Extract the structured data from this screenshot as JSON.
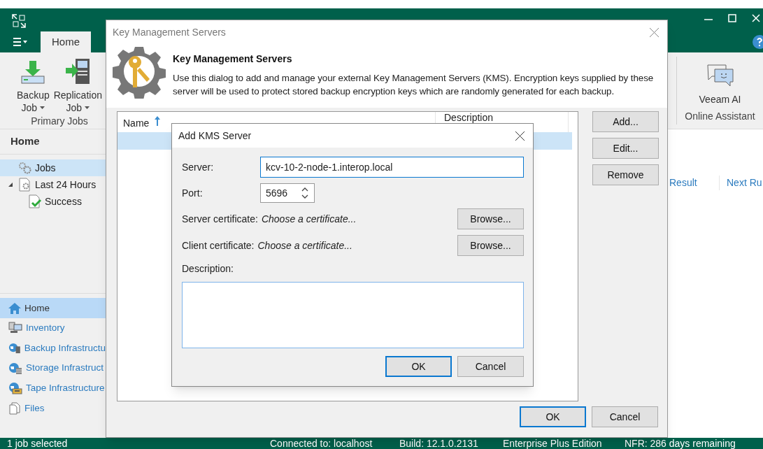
{
  "tabs": [
    {
      "label": "Home",
      "selected": true
    }
  ],
  "ribbon": {
    "groups": [
      {
        "label": "Primary Jobs",
        "buttons": [
          {
            "kind": "backup",
            "line1": "Backup",
            "line2": "Job"
          },
          {
            "kind": "replication",
            "line1": "Replication",
            "line2": "Job"
          }
        ]
      },
      {
        "label": "Online Assistant",
        "buttons": [
          {
            "kind": "assistant",
            "line1": "Veeam AI"
          }
        ]
      }
    ]
  },
  "sidebar": {
    "title": "Home",
    "tree": [
      {
        "label": "Jobs",
        "kind": "jobs",
        "selected": true
      },
      {
        "label": "Last 24 Hours",
        "kind": "history",
        "selected": false,
        "expanded": true,
        "children": [
          {
            "label": "Success",
            "kind": "success",
            "selected": false
          }
        ]
      }
    ],
    "nav": [
      {
        "label": "Home",
        "kind": "home",
        "selected": true
      },
      {
        "label": "Inventory",
        "kind": "inventory",
        "selected": false
      },
      {
        "label": "Backup Infrastructu",
        "kind": "backup",
        "selected": false
      },
      {
        "label": "Storage Infrastruct",
        "kind": "storage",
        "selected": false
      },
      {
        "label": "Tape Infrastructure",
        "kind": "tape",
        "selected": false
      },
      {
        "label": "Files",
        "kind": "files",
        "selected": false
      }
    ]
  },
  "content": {
    "columns": [
      "Result",
      "Next Ru"
    ]
  },
  "status_bar": [
    "1 job selected",
    "Connected to: localhost",
    "Build: 12.1.0.2131",
    "Enterprise Plus Edition",
    "NFR: 286 days remaining"
  ],
  "kms_dialog": {
    "title": "Key Management Servers",
    "heading": "Key Management Servers",
    "description": "Use this dialog to add and manage your external Key Management Servers (KMS). Encryption keys supplied by these server will be used to protect stored backup encryption keys which are randomly generated for each backup.",
    "table": {
      "columns": [
        {
          "label": "Name",
          "sorted": true
        },
        {
          "label": "Description"
        }
      ],
      "rows": [
        {
          "selected": true
        }
      ]
    },
    "side_buttons": [
      "Add...",
      "Edit...",
      "Remove"
    ],
    "footer": [
      {
        "label": "OK",
        "default": true
      },
      {
        "label": "Cancel",
        "default": false
      }
    ]
  },
  "add_dialog": {
    "title": "Add KMS Server",
    "fields": [
      {
        "kind": "text",
        "label": "Server:",
        "value": "kcv-10-2-node-1.interop.local",
        "focused": true
      },
      {
        "kind": "spin",
        "label": "Port:",
        "value": "5696",
        "focused": false
      },
      {
        "kind": "file",
        "label": "Server certificate:",
        "hint": "Choose a certificate...",
        "button": "Browse..."
      },
      {
        "kind": "file",
        "label": "Client certificate:",
        "hint": "Choose a certificate...",
        "button": "Browse..."
      },
      {
        "kind": "textarea",
        "label": "Description:",
        "focused": false
      }
    ],
    "footer": [
      {
        "label": "OK",
        "default": true
      },
      {
        "label": "Cancel",
        "default": false
      }
    ]
  }
}
